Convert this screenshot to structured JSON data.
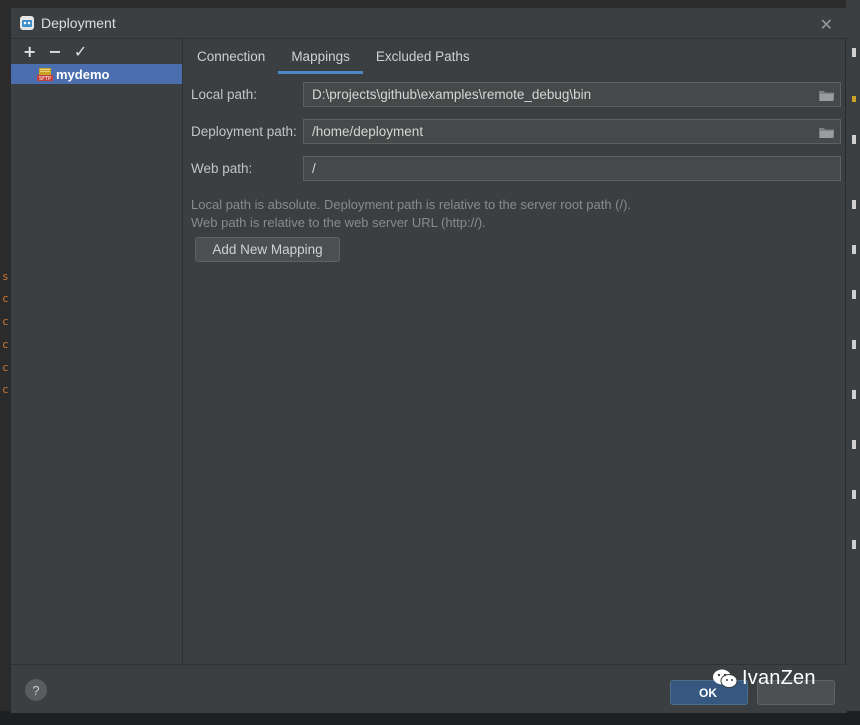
{
  "window": {
    "title": "Deployment"
  },
  "left_toolbar": {
    "add": "+",
    "remove": "−",
    "apply": "✓"
  },
  "servers": [
    {
      "name": "mydemo",
      "icon": "sftp-server-icon"
    }
  ],
  "tabs": [
    {
      "label": "Connection",
      "active": false
    },
    {
      "label": "Mappings",
      "active": true
    },
    {
      "label": "Excluded Paths",
      "active": false
    }
  ],
  "mapping": {
    "local_path_label": "Local path:",
    "local_path_value": "D:\\projects\\github\\examples\\remote_debug\\bin",
    "deployment_path_label": "Deployment path:",
    "deployment_path_value": "/home/deployment",
    "web_path_label": "Web path:",
    "web_path_value": "/"
  },
  "hint": {
    "line1": "Local path is absolute. Deployment path is relative to the server root path (/).",
    "line2": "Web path is relative to the web server URL (http://)."
  },
  "buttons": {
    "add_mapping": "Add New Mapping",
    "help": "?",
    "ok": "OK"
  },
  "watermark": {
    "text": "IvanZen"
  },
  "colors": {
    "dialog_bg": "#3c3f41",
    "selection": "#4b6eaf",
    "tab_underline": "#4a88c7",
    "ok_button": "#365880"
  }
}
